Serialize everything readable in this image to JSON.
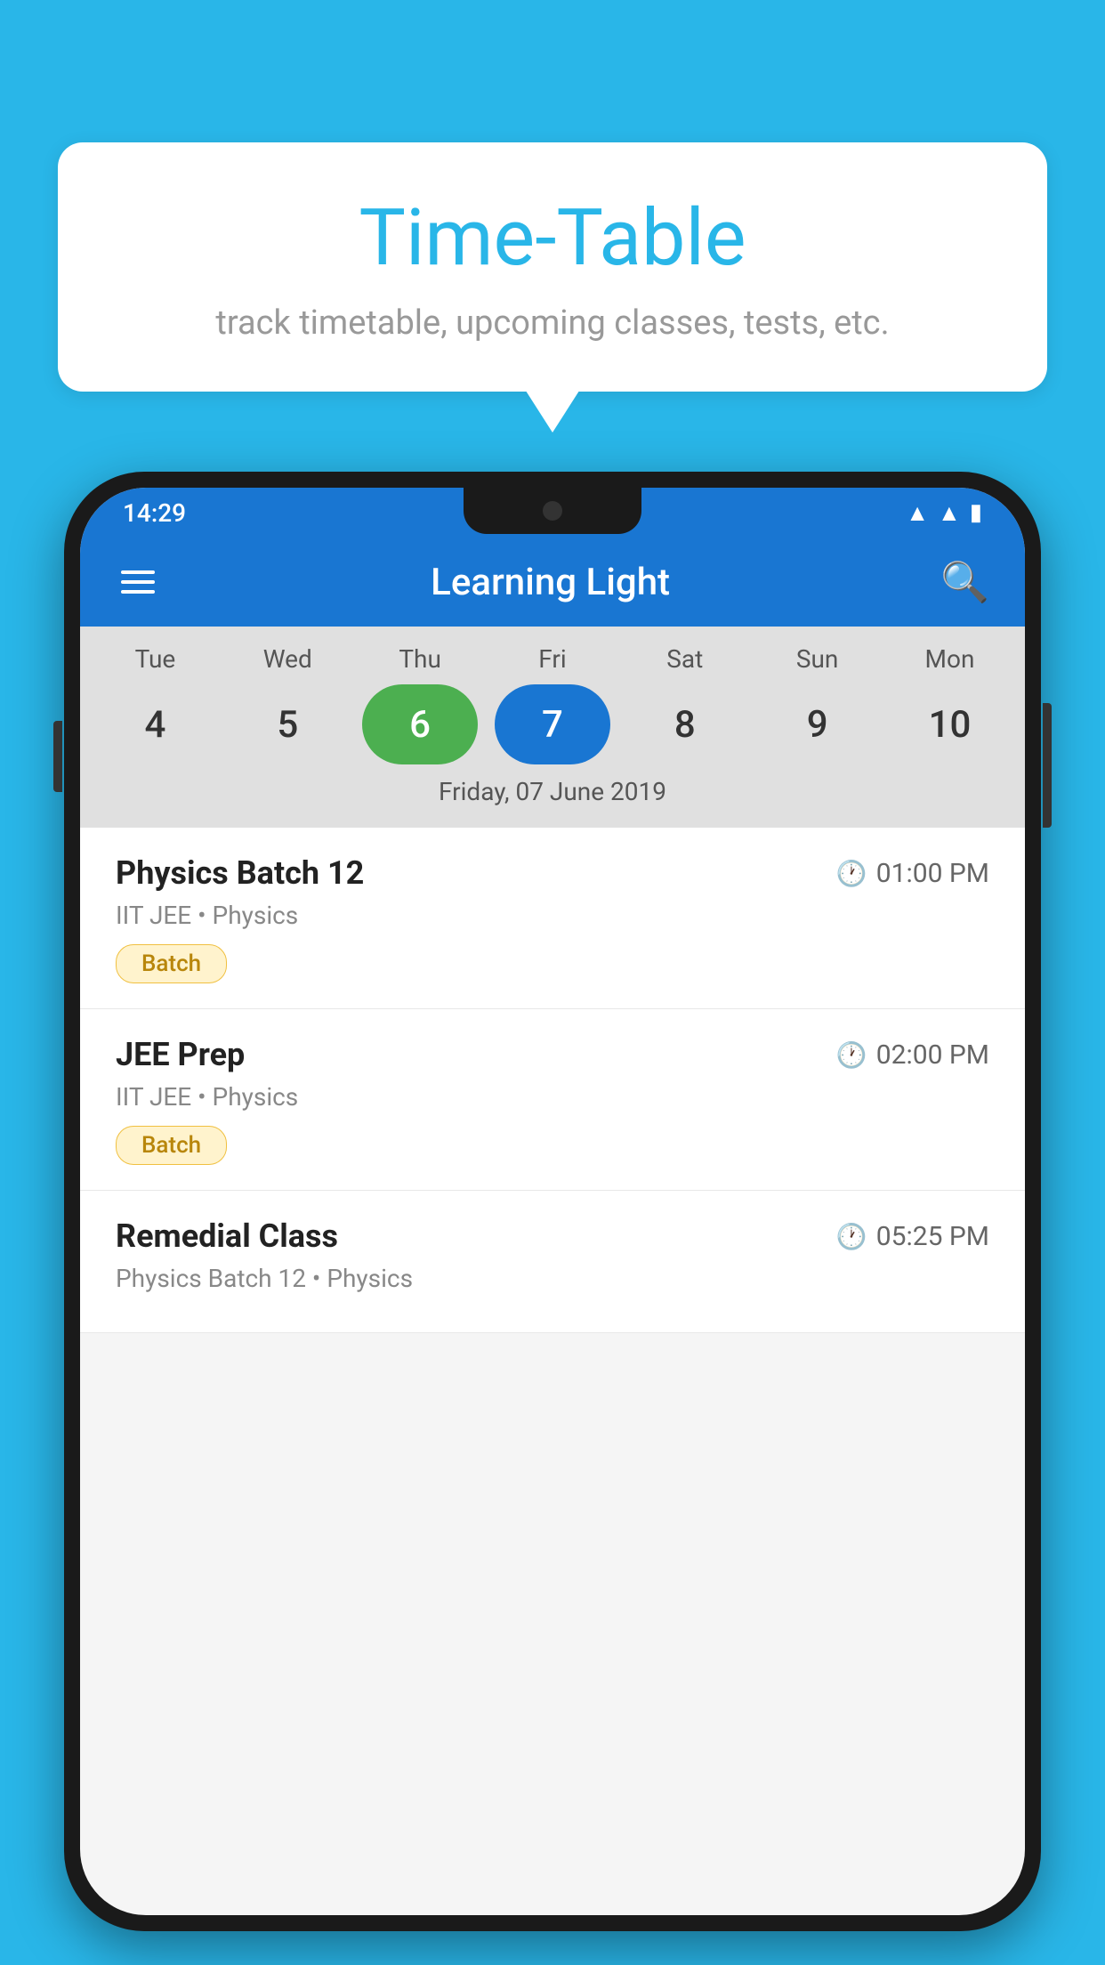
{
  "background_color": "#29b6e8",
  "speech_bubble": {
    "title": "Time-Table",
    "subtitle": "track timetable, upcoming classes, tests, etc."
  },
  "phone": {
    "status_bar": {
      "time": "14:29"
    },
    "app_bar": {
      "title": "Learning Light"
    },
    "calendar": {
      "days": [
        {
          "label": "Tue",
          "num": "4"
        },
        {
          "label": "Wed",
          "num": "5"
        },
        {
          "label": "Thu",
          "num": "6",
          "state": "today"
        },
        {
          "label": "Fri",
          "num": "7",
          "state": "selected"
        },
        {
          "label": "Sat",
          "num": "8"
        },
        {
          "label": "Sun",
          "num": "9"
        },
        {
          "label": "Mon",
          "num": "10"
        }
      ],
      "selected_date": "Friday, 07 June 2019"
    },
    "schedule": [
      {
        "title": "Physics Batch 12",
        "time": "01:00 PM",
        "subtitle": "IIT JEE • Physics",
        "tag": "Batch"
      },
      {
        "title": "JEE Prep",
        "time": "02:00 PM",
        "subtitle": "IIT JEE • Physics",
        "tag": "Batch"
      },
      {
        "title": "Remedial Class",
        "time": "05:25 PM",
        "subtitle": "Physics Batch 12 • Physics",
        "tag": null
      }
    ]
  }
}
